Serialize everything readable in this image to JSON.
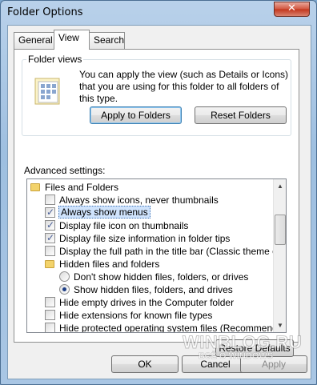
{
  "window": {
    "title": "Folder Options",
    "close_glyph": "✕"
  },
  "tabs": [
    {
      "label": "General"
    },
    {
      "label": "View"
    },
    {
      "label": "Search"
    }
  ],
  "folder_views": {
    "label": "Folder views",
    "description": "You can apply the view (such as Details or Icons) that you are using for this folder to all folders of this type.",
    "apply_button": "Apply to Folders",
    "reset_button": "Reset Folders"
  },
  "advanced": {
    "label": "Advanced settings:",
    "items": [
      {
        "type": "folder",
        "label": "Files and Folders"
      },
      {
        "type": "checkbox",
        "label": "Always show icons, never thumbnails",
        "checked": false
      },
      {
        "type": "checkbox",
        "label": "Always show menus",
        "checked": true,
        "selected": true
      },
      {
        "type": "checkbox",
        "label": "Display file icon on thumbnails",
        "checked": true
      },
      {
        "type": "checkbox",
        "label": "Display file size information in folder tips",
        "checked": true
      },
      {
        "type": "checkbox",
        "label": "Display the full path in the title bar (Classic theme only)",
        "checked": false
      },
      {
        "type": "folder",
        "label": "Hidden files and folders"
      },
      {
        "type": "radio",
        "label": "Don't show hidden files, folders, or drives",
        "checked": false
      },
      {
        "type": "radio",
        "label": "Show hidden files, folders, and drives",
        "checked": true
      },
      {
        "type": "checkbox",
        "label": "Hide empty drives in the Computer folder",
        "checked": false
      },
      {
        "type": "checkbox",
        "label": "Hide extensions for known file types",
        "checked": false
      },
      {
        "type": "checkbox",
        "label": "Hide protected operating system files (Recommended)",
        "checked": false
      }
    ]
  },
  "buttons": {
    "restore_defaults": "Restore Defaults",
    "ok": "OK",
    "cancel": "Cancel",
    "apply": "Apply"
  },
  "watermark": {
    "line1": "WINBLOG.RU",
    "line2": "ВСЁ О WINDOWS"
  },
  "colors": {
    "selection": "#cfe3fc",
    "check": "#4a5f97",
    "folder": "#f3d36b"
  }
}
